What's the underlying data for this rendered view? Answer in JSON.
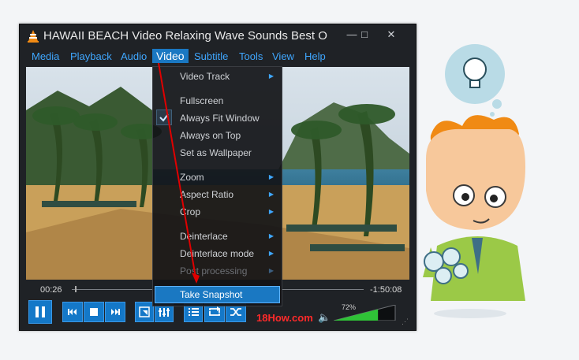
{
  "window": {
    "title": "HAWAII BEACH Video Relaxing Wave Sounds Best Oc...",
    "controls": {
      "minimize": "—",
      "maximize": "□",
      "close": "✕"
    }
  },
  "menubar": [
    "Media",
    "Playback",
    "Audio",
    "Video",
    "Subtitle",
    "Tools",
    "View",
    "Help"
  ],
  "video_menu": {
    "items": [
      {
        "label": "Video Track",
        "submenu": true,
        "enabled": true,
        "checked": false
      },
      {
        "label": "Fullscreen",
        "submenu": false,
        "enabled": true,
        "checked": false
      },
      {
        "label": "Always Fit Window",
        "submenu": false,
        "enabled": true,
        "checked": true
      },
      {
        "label": "Always on Top",
        "submenu": false,
        "enabled": true,
        "checked": false
      },
      {
        "label": "Set as Wallpaper",
        "submenu": false,
        "enabled": true,
        "checked": false
      },
      {
        "label": "Zoom",
        "submenu": true,
        "enabled": true,
        "checked": false
      },
      {
        "label": "Aspect Ratio",
        "submenu": true,
        "enabled": true,
        "checked": false
      },
      {
        "label": "Crop",
        "submenu": true,
        "enabled": true,
        "checked": false
      },
      {
        "label": "Deinterlace",
        "submenu": true,
        "enabled": true,
        "checked": false
      },
      {
        "label": "Deinterlace mode",
        "submenu": true,
        "enabled": true,
        "checked": false
      },
      {
        "label": "Post processing",
        "submenu": true,
        "enabled": false,
        "checked": false
      }
    ],
    "highlighted": "Take Snapshot"
  },
  "playback": {
    "elapsed": "00:26",
    "remaining": "-1:50:08",
    "progress_fraction": 0.01
  },
  "volume": {
    "percent_label": "72%",
    "level_fraction": 0.72
  },
  "watermark": "18How.com",
  "colors": {
    "accent": "#1a78c2",
    "menu_text": "#3fa7ff",
    "annotation_arrow": "#e00000",
    "volume_fill": "#2fc337"
  },
  "icons": [
    "vlc-cone-icon",
    "pause-icon",
    "previous-icon",
    "stop-icon",
    "next-icon",
    "fullscreen-icon",
    "equalizer-icon",
    "playlist-icon",
    "loop-icon",
    "shuffle-icon",
    "speaker-icon",
    "lightbulb-icon"
  ]
}
